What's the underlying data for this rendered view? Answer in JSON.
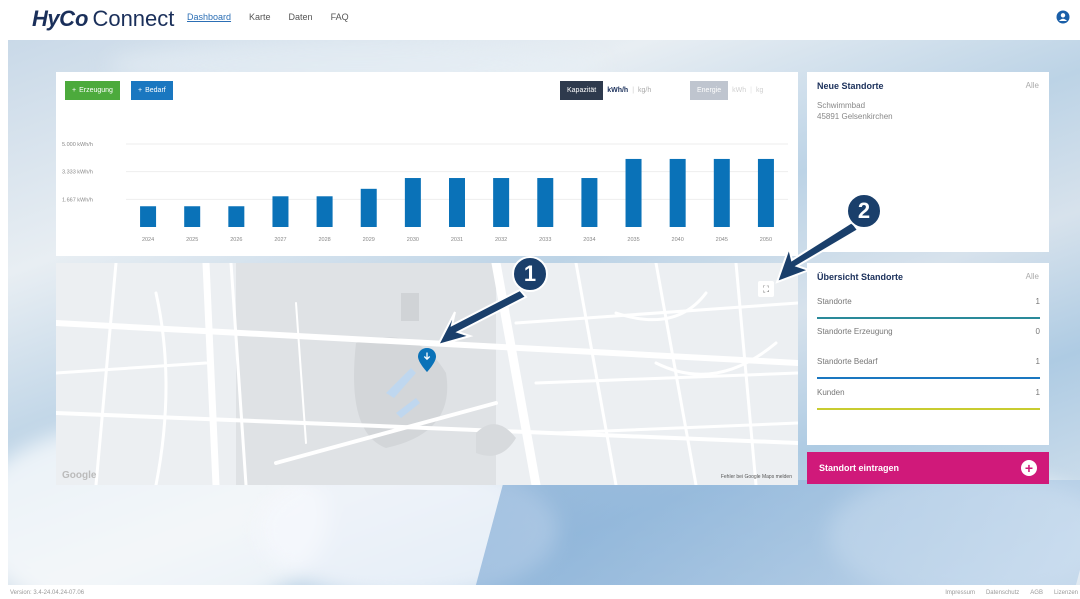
{
  "header": {
    "logo_hy": "Hy",
    "logo_co": "Co",
    "logo_connect": "Connect",
    "nav": [
      "Dashboard",
      "Karte",
      "Daten",
      "FAQ"
    ],
    "active_nav": "Dashboard"
  },
  "chart_panel": {
    "btn_erzeugung": "Erzeugung",
    "btn_bedarf": "Bedarf",
    "toggle_kapazitaet": {
      "label": "Kapazität",
      "opt1": "kWh/h",
      "opt2": "kg/h"
    },
    "toggle_energie": {
      "label": "Energie",
      "opt1": "kWh",
      "opt2": "kg"
    }
  },
  "chart_data": {
    "type": "bar",
    "categories": [
      "2024",
      "2025",
      "2026",
      "2027",
      "2028",
      "2029",
      "2030",
      "2031",
      "2032",
      "2033",
      "2034",
      "2035",
      "2040",
      "2045",
      "2050"
    ],
    "values": [
      1250,
      1250,
      1250,
      1850,
      1850,
      2300,
      2950,
      2950,
      2950,
      2950,
      2950,
      4100,
      4100,
      4100,
      4100
    ],
    "yticks": [
      "5.000 kWh/h",
      "3.333 kWh/h",
      "1.667 kWh/h"
    ],
    "ytick_values": [
      5000,
      3333,
      1667
    ],
    "ylim": [
      0,
      5000
    ],
    "color": "#0a72b8",
    "grid": true
  },
  "map": {
    "google": "Google",
    "report": "Fehler bei Google Maps melden"
  },
  "panel_neu": {
    "title": "Neue Standorte",
    "alle": "Alle",
    "name": "Schwimmbad",
    "address": "45891 Gelsenkirchen"
  },
  "panel_uebersicht": {
    "title": "Übersicht Standorte",
    "alle": "Alle",
    "rows": [
      {
        "label": "Standorte",
        "value": "1",
        "color": "#2a8a9a"
      },
      {
        "label": "Standorte Erzeugung",
        "value": "0",
        "color": ""
      },
      {
        "label": "Standorte Bedarf",
        "value": "1",
        "color": "#1a77c0"
      },
      {
        "label": "Kunden",
        "value": "1",
        "color": "#c8cc30"
      }
    ]
  },
  "action": {
    "label": "Standort eintragen"
  },
  "annotations": {
    "badge1": "1",
    "badge2": "2"
  },
  "footer": {
    "version": "Version: 3.4-24.04.24-07.06",
    "links": [
      "Impressum",
      "Datenschutz",
      "AGB",
      "Lizenzen"
    ]
  }
}
